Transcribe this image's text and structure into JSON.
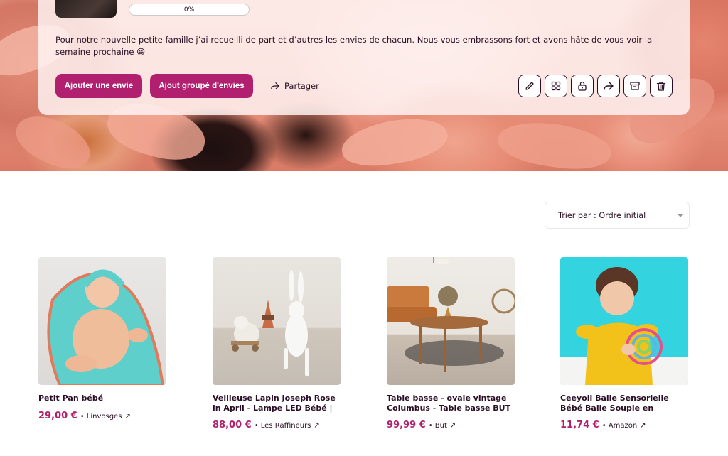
{
  "wishlist": {
    "progress_text": "0%",
    "progress_value": 0,
    "description": "Pour notre nouvelle petite famille j’ai recueilli de part et d’autres les envies de chacun. Nous vous embrassons fort et avons hâte de vous voir la semaine prochaine 😀",
    "add_wish_label": "Ajouter une envie",
    "group_add_label": "Ajout groupé d'envies",
    "share_label": "Partager",
    "actions": [
      {
        "icon": "pencil-icon",
        "name": "edit-button"
      },
      {
        "icon": "grid-icon",
        "name": "layout-button"
      },
      {
        "icon": "lock-icon",
        "name": "privacy-button"
      },
      {
        "icon": "share-icon",
        "name": "share-icon-button"
      },
      {
        "icon": "archive-icon",
        "name": "archive-button"
      },
      {
        "icon": "trash-icon",
        "name": "delete-button"
      }
    ]
  },
  "sort": {
    "label": "Trier par : Ordre initial"
  },
  "products": [
    {
      "title": "Petit Pan bébé",
      "price": "29,00 €",
      "store": "• Linvosges"
    },
    {
      "title": "Veilleuse Lapin Joseph Rose in April - Lampe LED Bébé | Lumièr…",
      "price": "88,00 €",
      "store": "• Les Raffineurs"
    },
    {
      "title": "Table basse - ovale vintage Columbus - Table basse BUT",
      "price": "99,99 €",
      "store": "• But"
    },
    {
      "title": "Ceeyoll Balle Sensorielle Bébé Balle Souple en Silicone Oball…",
      "price": "11,74 €",
      "store": "• Amazon"
    }
  ],
  "colors": {
    "accent": "#b0206f",
    "text": "#2a0e25"
  }
}
